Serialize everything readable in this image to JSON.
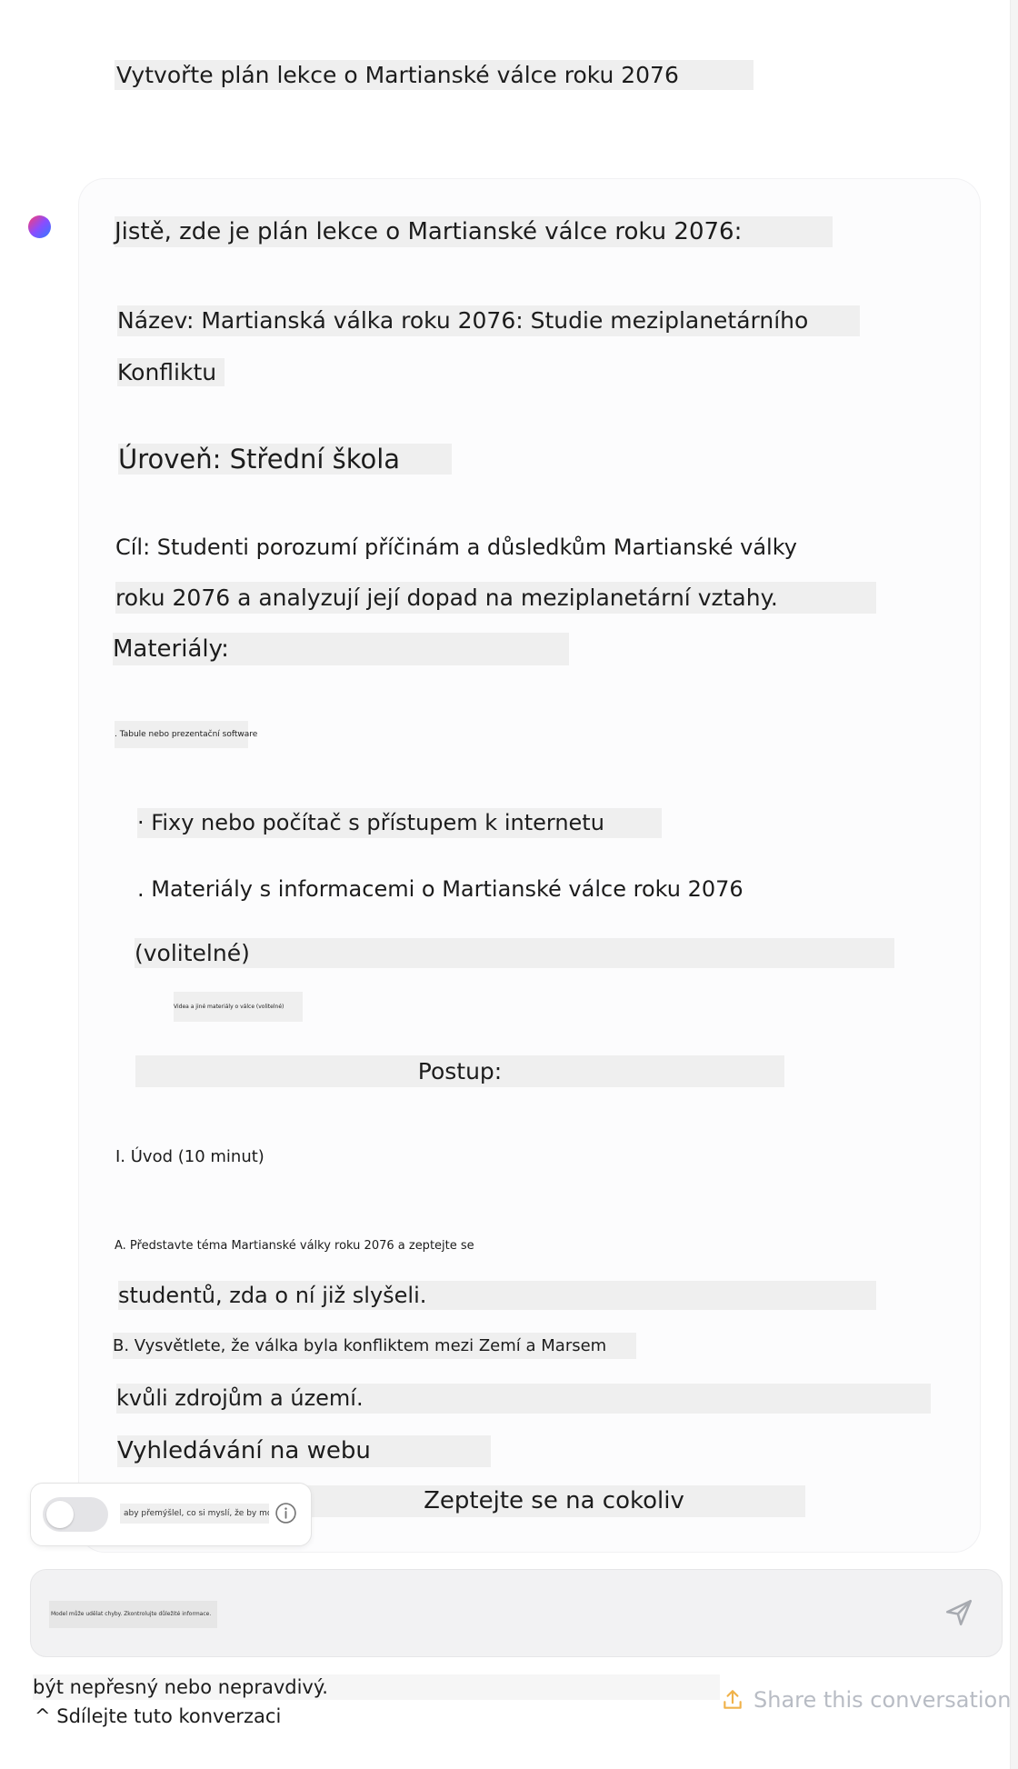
{
  "user_message": "Vytvořte plán lekce o Martianské válce roku 2076",
  "reply": {
    "intro": "Jistě, zde je plán lekce o Martianské válce roku 2076:",
    "title_line1": "Název: Martianská válka roku 2076: Studie meziplanetárního",
    "title_line2": "Konfliktu",
    "level": "Úroveň: Střední škola",
    "goal_line1": "Cíl: Studenti porozumí příčinám a důsledkům Martianské války",
    "goal_line2": "roku 2076 a analyzují její dopad na meziplanetární vztahy.",
    "materials_heading": "Materiály:",
    "material_1": ". Tabule nebo prezentační software",
    "material_2": "· Fixy nebo počítač s přístupem k internetu",
    "material_3_line1": ". Materiály s informacemi o Martianské válce roku 2076",
    "material_3_line2": "(volitelné)",
    "material_4": "Videa a jiné materiály o válce (volitelné)",
    "procedure_heading": "Postup:",
    "step_1": "I. Úvod (10 minut)",
    "step_1a_line1": "A. Představte téma Martianské války roku 2076 a zeptejte se",
    "step_1a_line2": "studentů, zda o ní již slyšeli.",
    "step_1b_line1": "B. Vysvětlete, že válka byla konfliktem mezi Zemí a Marsem",
    "step_1b_line2": "kvůli zdrojům a území.",
    "web_search": "Vyhledávání na webu",
    "ask_anything": "Zeptejte se na cokoliv"
  },
  "toggle": {
    "label": "aby přemýšlel, co si myslí, že by mohlo",
    "on": false
  },
  "composer": {
    "text": "Model může udělat chyby. Zkontrolujte důležité informace."
  },
  "footer": {
    "disclaimer": "být nepřesný nebo nepravdivý.",
    "share_cz": "^ Sdílejte tuto konverzaci",
    "share_en": "Share this conversation"
  },
  "colors": {
    "highlight": "#efefef",
    "muted_text": "#b8bcc4",
    "share_icon": "#f0b24a"
  },
  "icons": {
    "avatar": "gradient-dot-icon",
    "info": "info-icon",
    "send": "send-icon",
    "share": "share-icon"
  }
}
